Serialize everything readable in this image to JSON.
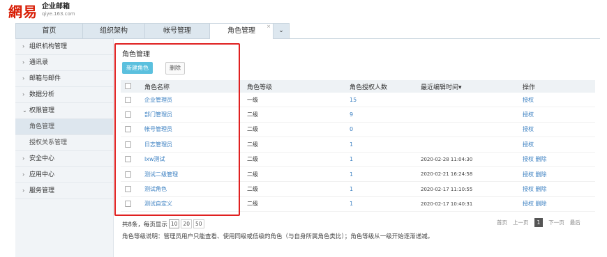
{
  "header": {
    "logo_mark": "網易",
    "logo_title": "企业邮箱",
    "logo_sub": "qiye.163.com"
  },
  "tabs": [
    {
      "label": "首页"
    },
    {
      "label": "组织架构"
    },
    {
      "label": "帐号管理"
    },
    {
      "label": "角色管理",
      "close": "×"
    }
  ],
  "tab_more_icon": "⌄",
  "sidebar": {
    "items": [
      {
        "chev": "›",
        "label": "组织机构管理"
      },
      {
        "chev": "›",
        "label": "通讯录"
      },
      {
        "chev": "›",
        "label": "邮箱与邮件"
      },
      {
        "chev": "›",
        "label": "数据分析"
      },
      {
        "chev": "⌄",
        "label": "权限管理"
      },
      {
        "label": "角色管理"
      },
      {
        "label": "授权关系管理"
      },
      {
        "chev": "›",
        "label": "安全中心"
      },
      {
        "chev": "›",
        "label": "应用中心"
      },
      {
        "chev": "›",
        "label": "服务管理"
      }
    ]
  },
  "main": {
    "title": "角色管理",
    "new_button": "新建角色",
    "delete_button": "删除",
    "columns": [
      "角色名称",
      "角色等级",
      "角色授权人数",
      "最近编辑时间▾",
      "操作"
    ],
    "rows": [
      {
        "name": "企业管理员",
        "level": "一级",
        "count": "15",
        "time": "",
        "op1": "授权",
        "op2": ""
      },
      {
        "name": "部门管理员",
        "level": "二级",
        "count": "9",
        "time": "",
        "op1": "授权",
        "op2": ""
      },
      {
        "name": "帐号管理员",
        "level": "二级",
        "count": "0",
        "time": "",
        "op1": "授权",
        "op2": ""
      },
      {
        "name": "日志管理员",
        "level": "二级",
        "count": "1",
        "time": "",
        "op1": "授权",
        "op2": ""
      },
      {
        "name": "lxw测试",
        "level": "二级",
        "count": "1",
        "time": "2020-02-28 11:04:30",
        "op1": "授权",
        "op2": "删除"
      },
      {
        "name": "测试二级管理",
        "level": "二级",
        "count": "1",
        "time": "2020-02-21 16:24:58",
        "op1": "授权",
        "op2": "删除"
      },
      {
        "name": "测试角色",
        "level": "二级",
        "count": "1",
        "time": "2020-02-17 11:10:55",
        "op1": "授权",
        "op2": "删除"
      },
      {
        "name": "测试自定义",
        "level": "二级",
        "count": "1",
        "time": "2020-02-17 10:40:31",
        "op1": "授权",
        "op2": "删除"
      }
    ]
  },
  "footer": {
    "summary": "共8条，每页显示",
    "page_sizes": [
      "10",
      "20",
      "50"
    ],
    "note": "角色等级说明：管理员用户只能查看、使用同级或低级的角色（与自身所属角色类比）；角色等级从一级开始逐渐递减。",
    "pager": {
      "first": "首页",
      "prev": "上一页",
      "current": "1",
      "next": "下一页",
      "last": "最后"
    }
  },
  "colors": {
    "highlight_border": "#e02020",
    "accent": "#5bc0de",
    "link": "#3a7fc1"
  }
}
